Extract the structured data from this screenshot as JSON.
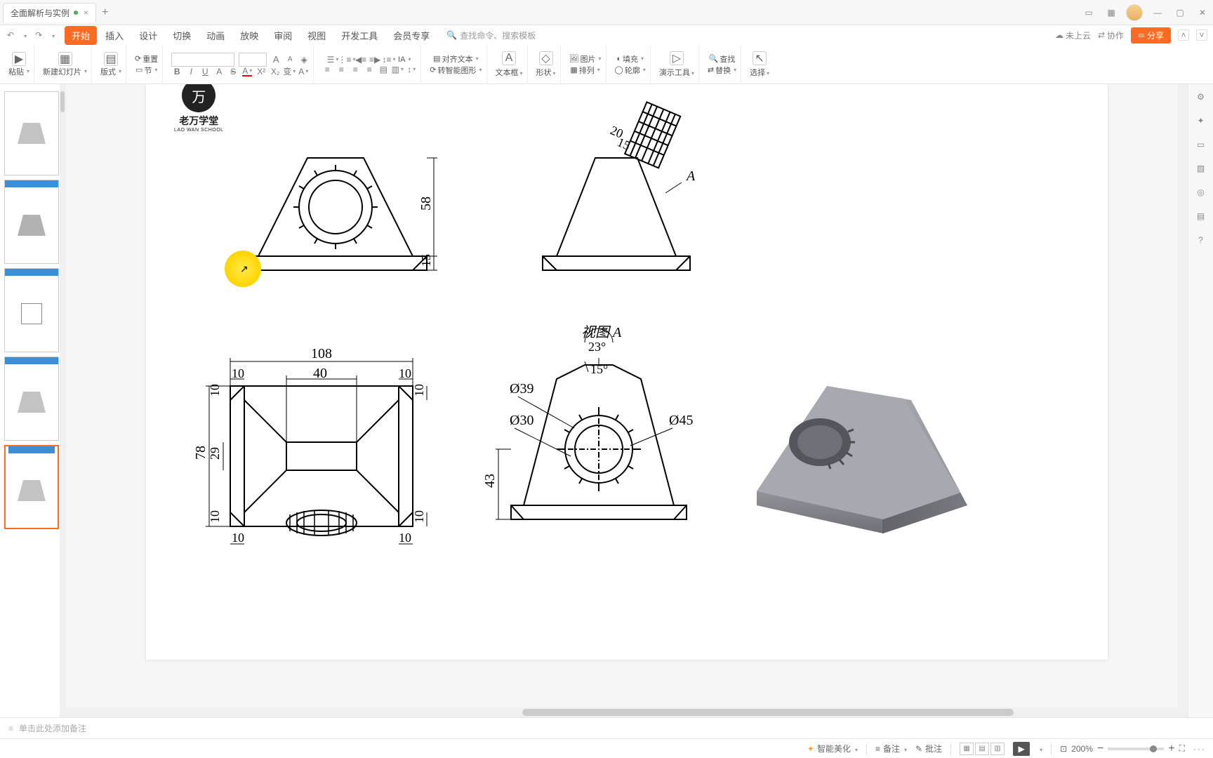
{
  "titlebar": {
    "doc_title": "全面解析与实例",
    "close": "×",
    "newtab": "+"
  },
  "qat": {
    "undo": "↶",
    "redo": "↷"
  },
  "menu": {
    "tabs": [
      "开始",
      "插入",
      "设计",
      "切换",
      "动画",
      "放映",
      "审阅",
      "视图",
      "开发工具",
      "会员专享"
    ],
    "search_placeholder": "查找命令、搜索模板"
  },
  "topright": {
    "cloud": "未上云",
    "collab": "协作",
    "share": "分享"
  },
  "ribbon": {
    "paste": "粘贴",
    "newslide": "新建幻灯片",
    "layout": "版式",
    "section": "节",
    "reset": "重置",
    "font_inc": "A",
    "font_dec": "A",
    "bold": "B",
    "italic": "I",
    "underline": "U",
    "strike": "S",
    "align_text": "对齐文本",
    "smart_shape": "转智能图形",
    "textbox": "文本框",
    "shape": "形状",
    "picture": "图片",
    "arrange": "排列",
    "fill": "填充",
    "outline": "轮廓",
    "demo": "演示工具",
    "find": "查找",
    "replace": "替换",
    "select": "选择"
  },
  "slide": {
    "logo_name": "老万学堂",
    "logo_sub": "LAO WAN SCHOOL",
    "d58": "58",
    "d15a": "15",
    "d20": "20",
    "d15b": "15",
    "dA": "A",
    "d108": "108",
    "d40": "40",
    "d10": "10",
    "d78": "78",
    "d29": "29",
    "viewA": "视图 A",
    "ang23": "23°",
    "ang15": "15°",
    "dia39": "Ø39",
    "dia30": "Ø30",
    "dia45": "Ø45",
    "d43": "43"
  },
  "notes": {
    "placeholder": "单击此处添加备注"
  },
  "status": {
    "beautify": "智能美化",
    "notes": "备注",
    "comments": "批注",
    "zoom_val": "200%",
    "more": "···"
  }
}
